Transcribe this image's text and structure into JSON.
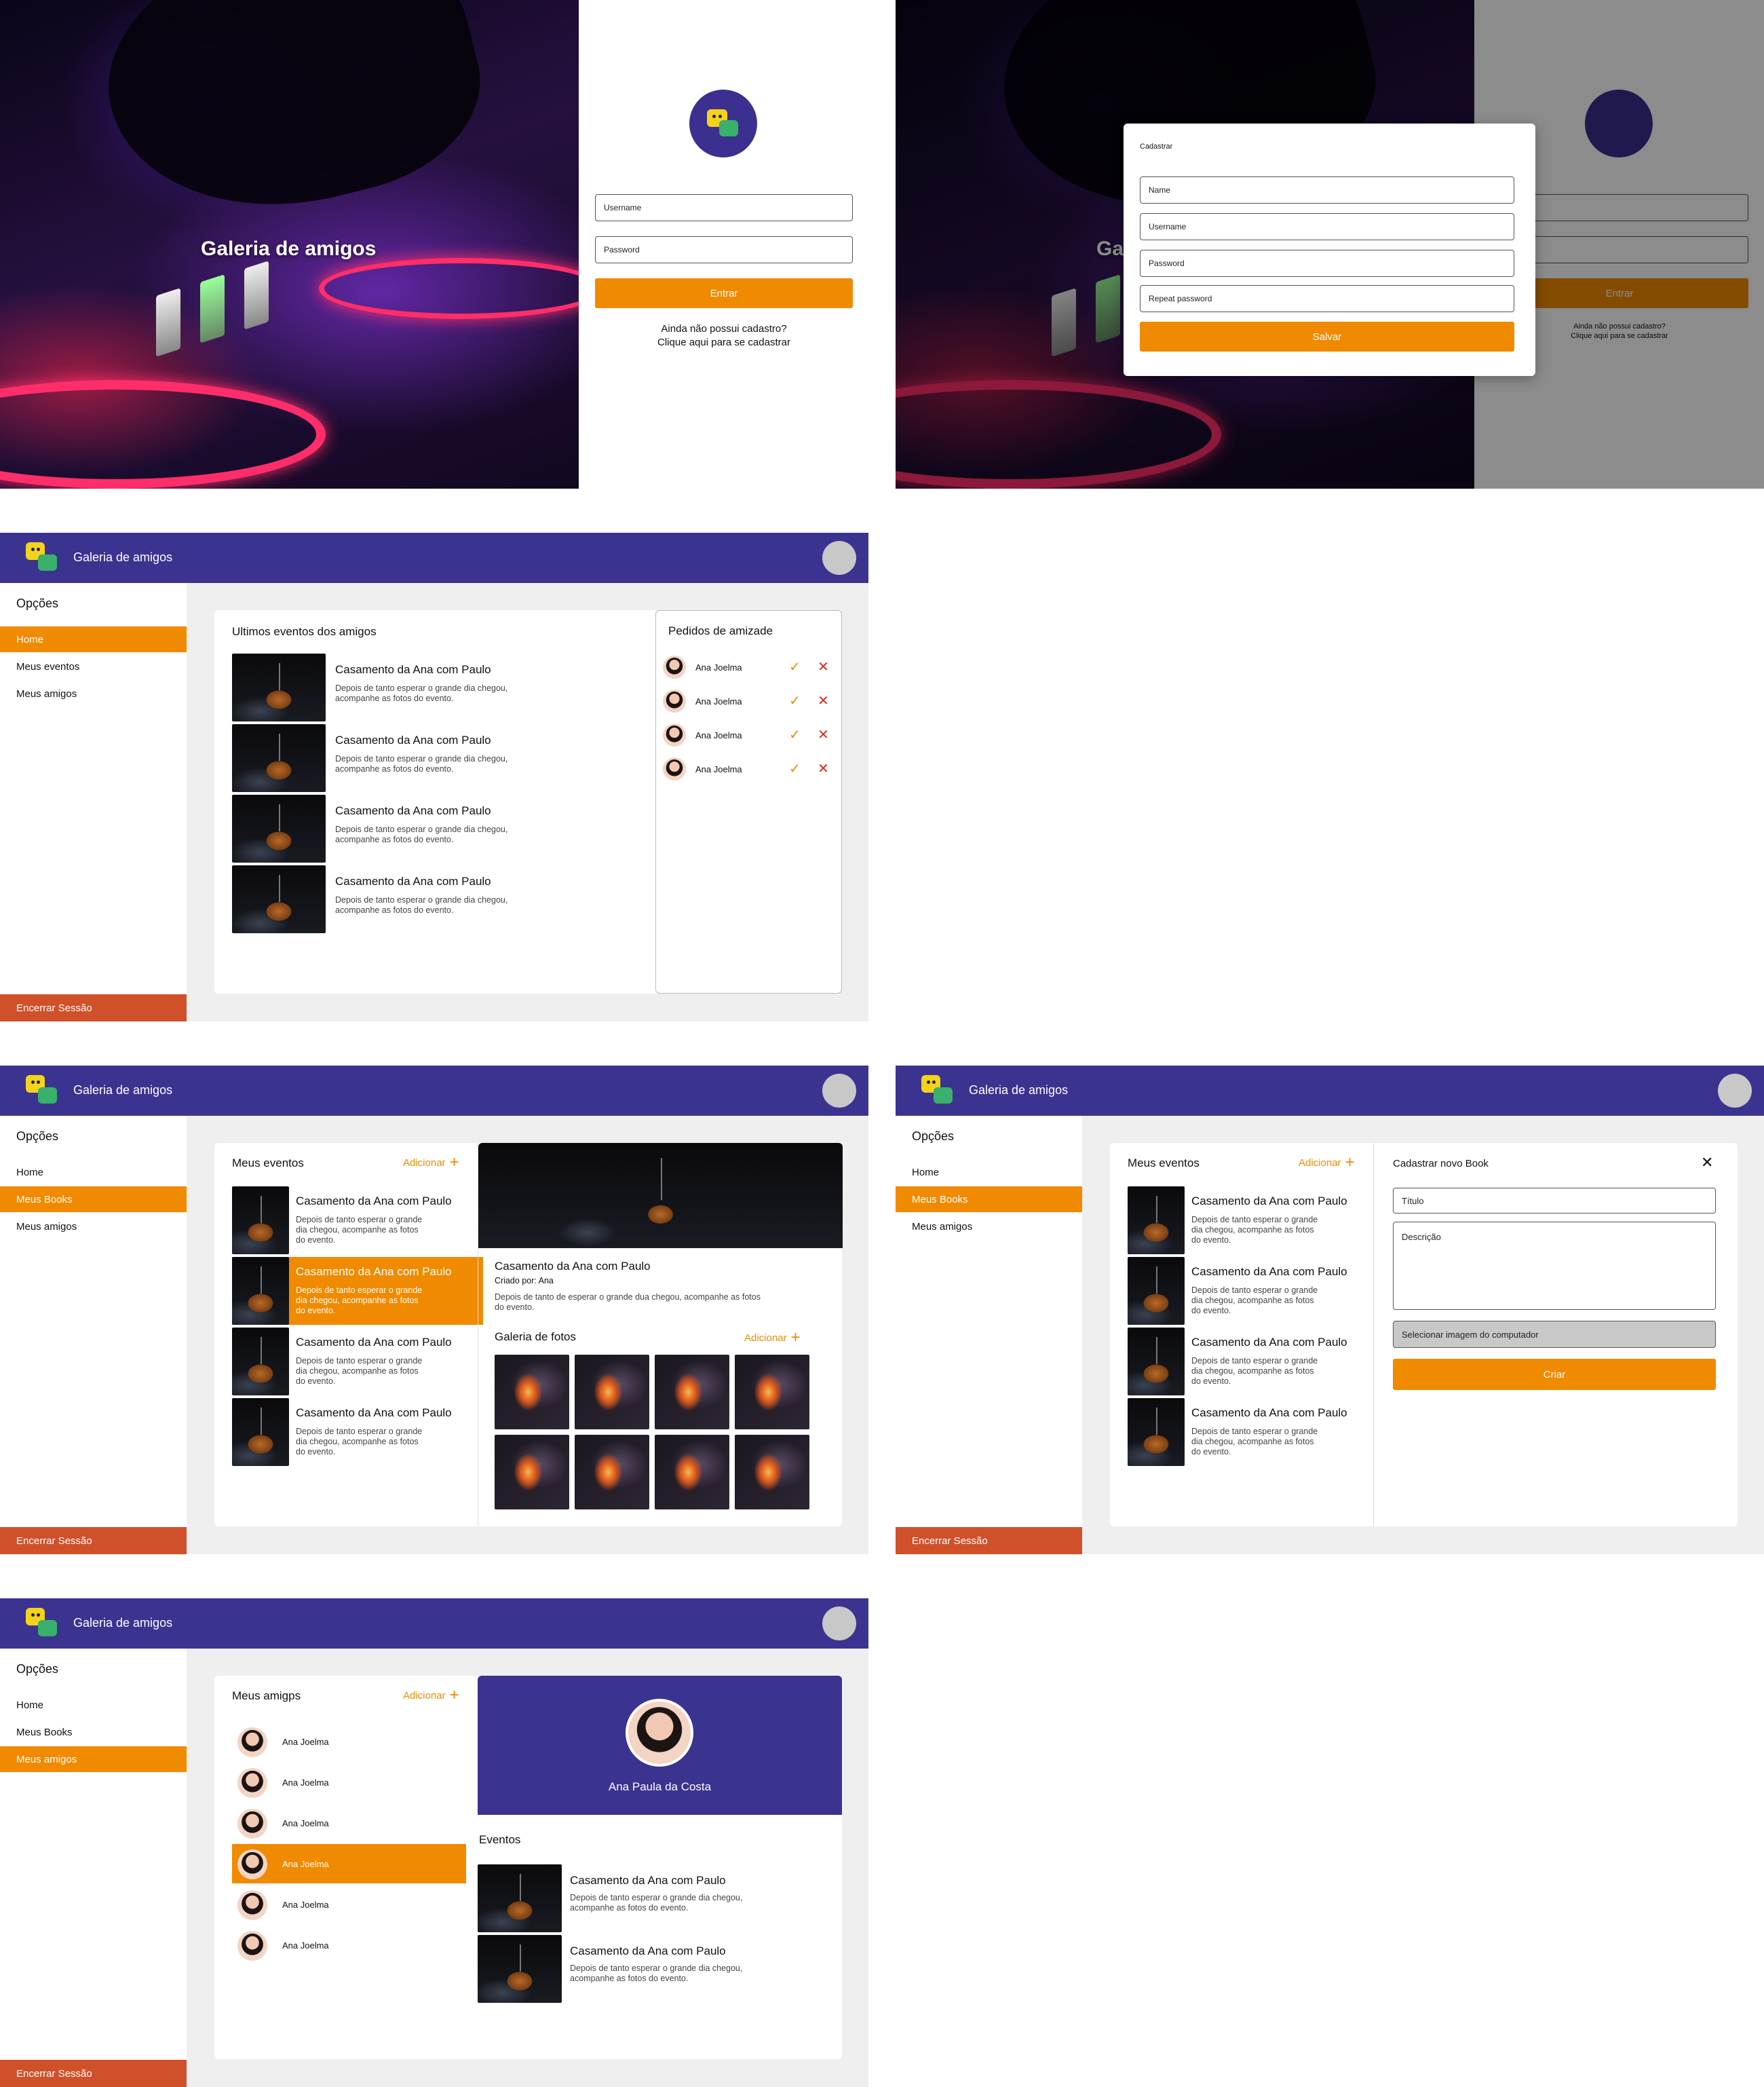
{
  "app": {
    "name": "Galeria de amigos"
  },
  "login": {
    "title": "Galeria de amigos",
    "username_placeholder": "Username",
    "password_placeholder": "Password",
    "enter": "Entrar",
    "no_account": "Ainda não possui cadastro?",
    "register_link": "Clique aqui para se cadastrar"
  },
  "register": {
    "heading": "Cadastrar",
    "name": "Name",
    "username": "Username",
    "password": "Password",
    "repeat": "Repeat password",
    "save": "Salvar"
  },
  "sidebar": {
    "heading": "Opções",
    "home": "Home",
    "my_events": "Meus eventos",
    "my_books": "Meus Books",
    "my_friends": "Meus amigos",
    "logout": "Encerrar Sessão"
  },
  "home": {
    "events_heading": "Ultimos eventos dos amigos",
    "requests_heading": "Pedidos de amizade",
    "event_title": "Casamento da Ana com Paulo",
    "event_desc_1": "Depois de tanto esperar o grande dia chegou,",
    "event_desc_2": "acompanhe as fotos do evento.",
    "request_name": "Ana Joelma"
  },
  "books": {
    "heading": "Meus eventos",
    "add": "Adicionar",
    "item_title": "Casamento da Ana com Paulo",
    "item_desc_1": "Depois de tanto esperar o grande",
    "item_desc_2": "dia chegou, acompanhe as fotos",
    "item_desc_3": "do evento.",
    "detail_title": "Casamento da Ana com Paulo",
    "detail_author": "Criado por: Ana",
    "detail_desc_1": "Depois de tanto de esperar o grande dua chegou, acompanhe as fotos",
    "detail_desc_2": "do evento.",
    "gallery_heading": "Galeria de fotos"
  },
  "new_book": {
    "heading": "Cadastrar novo Book",
    "title_placeholder": "Título",
    "desc_placeholder": "Descrição",
    "select_image": "Selecionar imagem do computador",
    "create": "Criar"
  },
  "friends": {
    "heading": "Meus amigps",
    "add": "Adicionar",
    "friend_name": "Ana Joelma",
    "profile_name": "Ana Paula da Costa",
    "events_heading": "Eventos"
  },
  "colors": {
    "purple": "#3b3390",
    "orange": "#f08a00",
    "logout": "#d0502a",
    "reject": "#d92b1c"
  }
}
